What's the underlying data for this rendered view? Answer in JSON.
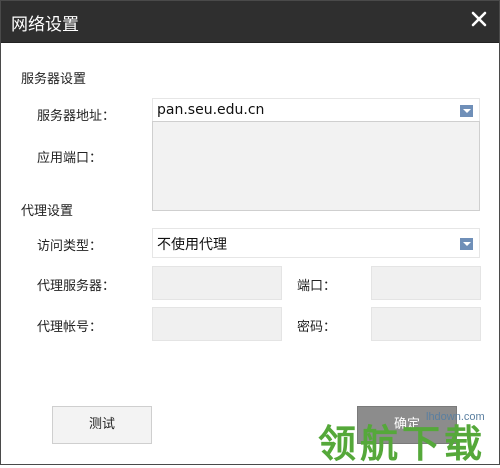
{
  "window": {
    "title": "网络设置"
  },
  "server": {
    "section_title": "服务器设置",
    "address_label": "服务器地址：",
    "address_value": "pan.seu.edu.cn",
    "port_label": "应用端口："
  },
  "proxy": {
    "section_title": "代理设置",
    "type_label": "访问类型：",
    "type_value": "不使用代理",
    "server_label": "代理服务器：",
    "port_label": "端口：",
    "account_label": "代理帐号：",
    "password_label": "密码："
  },
  "buttons": {
    "test": "测试",
    "ok": "确定"
  },
  "watermark": {
    "url": "lhdown.com",
    "text": "领航下载"
  },
  "colors": {
    "titlebar": "#2f2f2f",
    "arrow": "#6f8fb8",
    "watermark": "#55a83a"
  }
}
